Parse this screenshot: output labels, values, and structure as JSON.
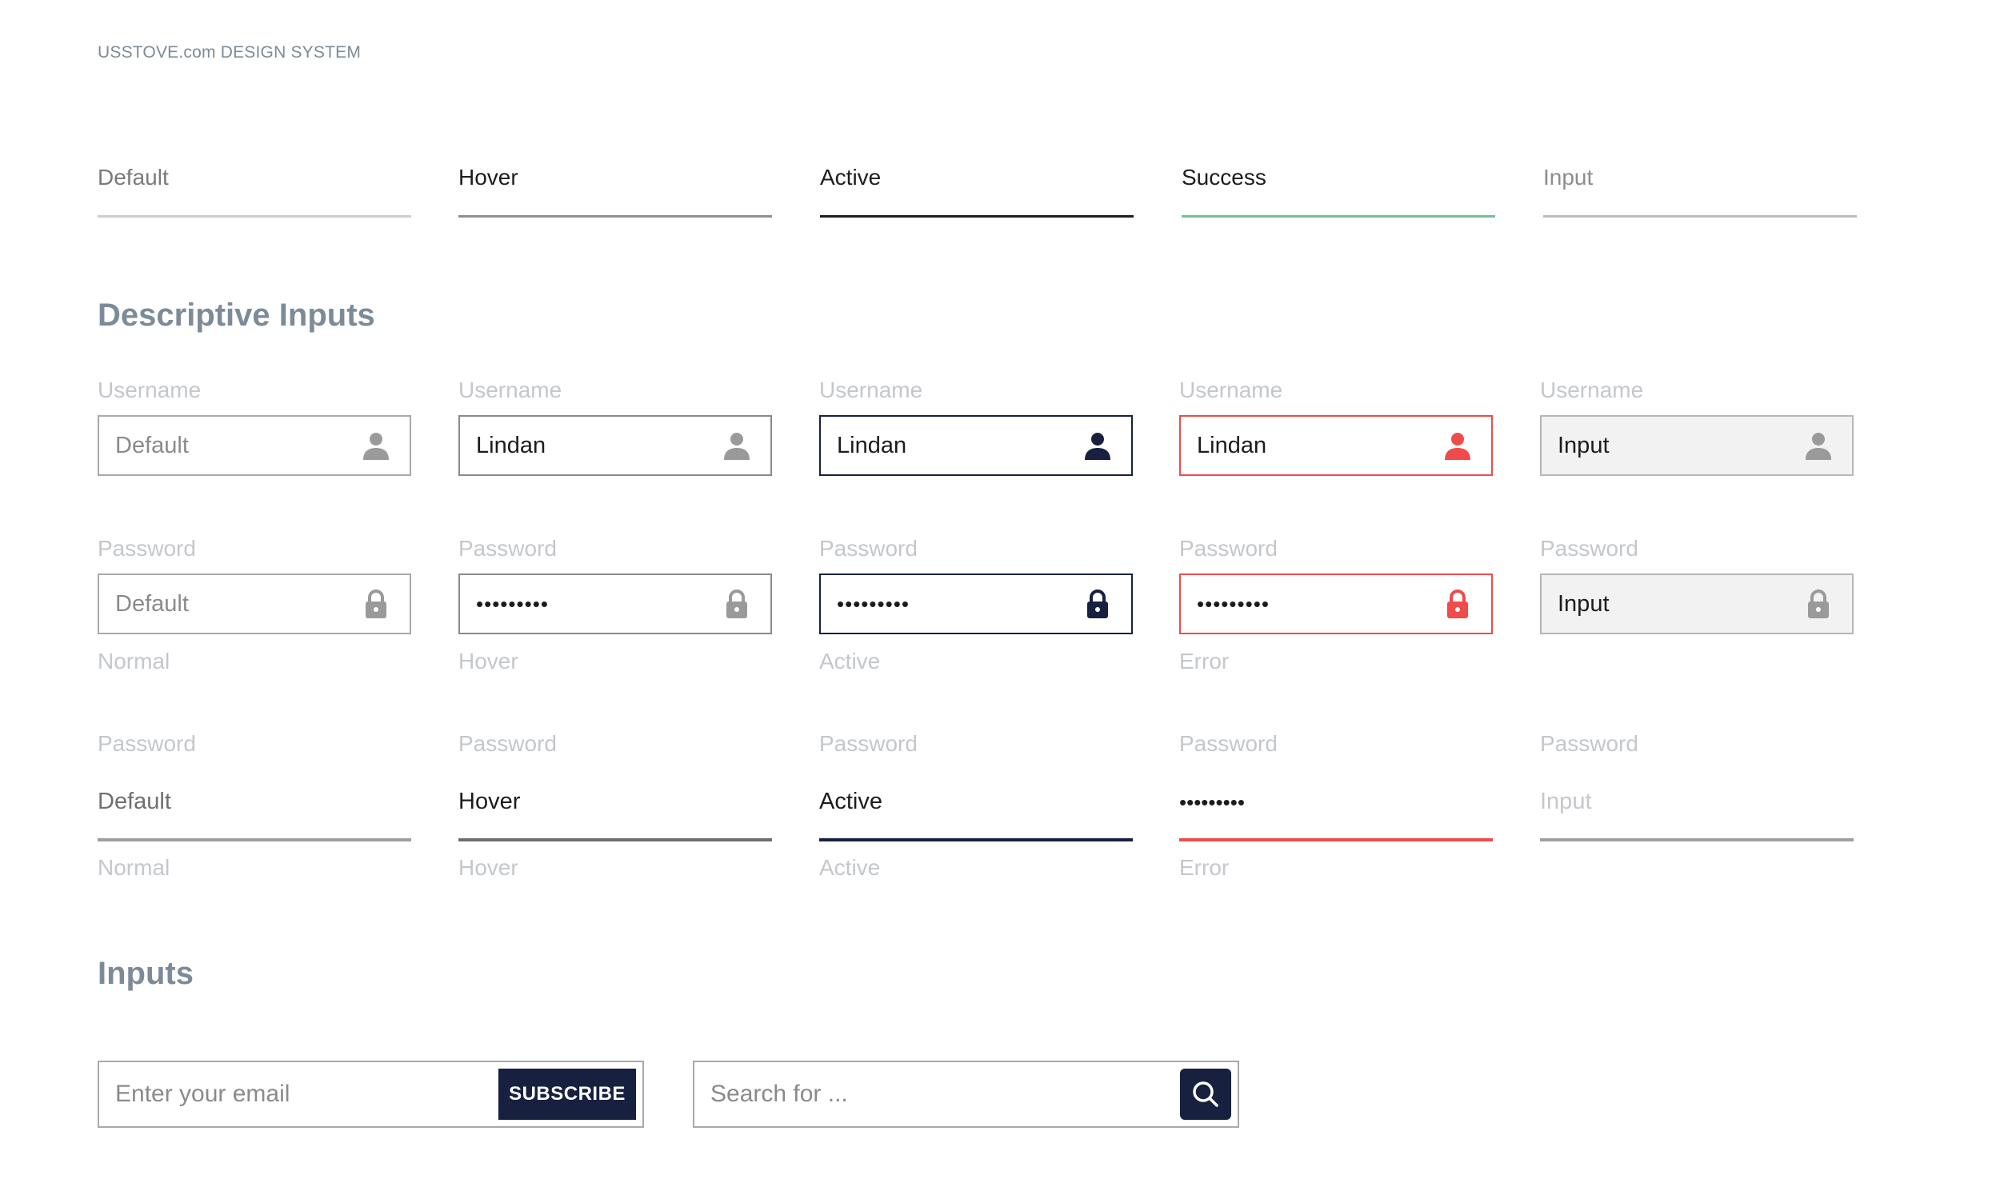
{
  "brand": "USSTOVE.com DESIGN SYSTEM",
  "top_row": [
    {
      "label": "Default",
      "label_color": "#7a7a7a",
      "line_color": "#cfcfcf"
    },
    {
      "label": "Hover",
      "label_color": "#1d1d1d",
      "line_color": "#8f8f8f"
    },
    {
      "label": "Active",
      "label_color": "#1d1d1d",
      "line_color": "#1e1e1e"
    },
    {
      "label": "Success",
      "label_color": "#1d1d1d",
      "line_color": "#6cc49a"
    },
    {
      "label": "Input",
      "label_color": "#8d8d8d",
      "line_color": "#bdbdbd"
    }
  ],
  "descriptive": {
    "title": "Descriptive Inputs",
    "username_row": [
      {
        "label": "Username",
        "value": "Default",
        "state": "default"
      },
      {
        "label": "Username",
        "value": "Lindan",
        "state": "hover"
      },
      {
        "label": "Username",
        "value": "Lindan",
        "state": "active"
      },
      {
        "label": "Username",
        "value": "Lindan",
        "state": "error"
      },
      {
        "label": "Username",
        "value": "Input",
        "state": "disabled"
      }
    ],
    "password_row": [
      {
        "label": "Password",
        "value": "Default",
        "caption": "Normal",
        "state": "default"
      },
      {
        "label": "Password",
        "value": "•••••••••",
        "caption": "Hover",
        "state": "hover"
      },
      {
        "label": "Password",
        "value": "•••••••••",
        "caption": "Active",
        "state": "active"
      },
      {
        "label": "Password",
        "value": "•••••••••",
        "caption": "Error",
        "state": "error"
      },
      {
        "label": "Password",
        "value": "Input",
        "caption": "",
        "state": "disabled"
      }
    ],
    "underline_row": [
      {
        "label": "Password",
        "value": "Default",
        "caption": "Normal",
        "state": "default"
      },
      {
        "label": "Password",
        "value": "Hover",
        "caption": "Hover",
        "state": "hover"
      },
      {
        "label": "Password",
        "value": "Active",
        "caption": "Active",
        "state": "active"
      },
      {
        "label": "Password",
        "value": "•••••••••",
        "caption": "Error",
        "state": "error"
      },
      {
        "label": "Password",
        "value": "Input",
        "caption": "",
        "state": "disabled"
      }
    ]
  },
  "inputs": {
    "title": "Inputs",
    "email_placeholder": "Enter your email",
    "subscribe_label": "SUBSCRIBE",
    "search_placeholder": "Search for ...",
    "search_icon": "search-icon"
  },
  "colors": {
    "navy": "#17213f",
    "error": "#ef4b4b",
    "success": "#6cc49a",
    "icon_gray": "#9a9a9a",
    "label_gray": "#c4c7cb",
    "title_gray": "#7d8b99"
  }
}
